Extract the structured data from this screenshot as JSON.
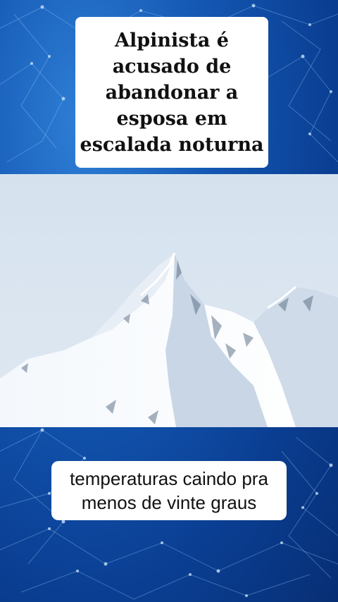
{
  "headline": {
    "text": "Alpinista é\nacusado de\nabandonar a\nesposa em\nescalada noturna"
  },
  "photo": {
    "subject": "mountain-photo"
  },
  "caption": {
    "text": "temperaturas caindo pra\nmenos de vinte graus"
  },
  "colors": {
    "background_blue": "#1458b4",
    "box_white": "#ffffff",
    "text": "#111111"
  }
}
